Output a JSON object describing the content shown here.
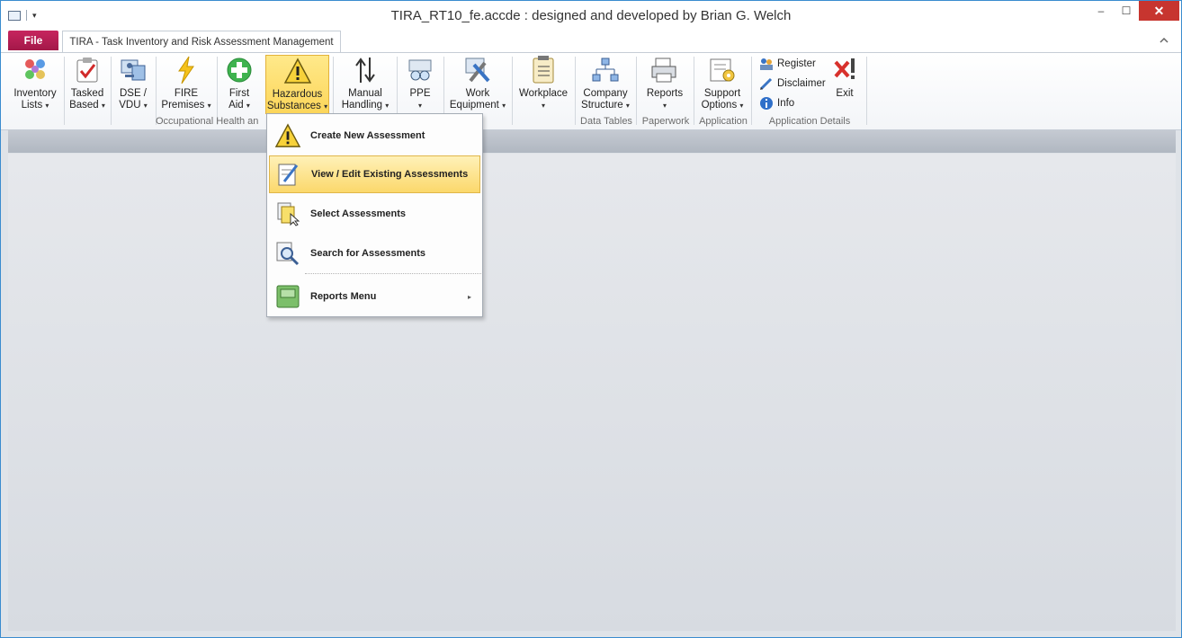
{
  "window": {
    "title": "TIRA_RT10_fe.accde : designed and developed by Brian G. Welch",
    "controls": {
      "minimize": "–",
      "maximize": "☐",
      "close": "✕"
    }
  },
  "tabs": {
    "file": "File",
    "main": "TIRA - Task Inventory and Risk Assessment Management"
  },
  "ribbon": {
    "buttons": [
      {
        "l1": "Inventory",
        "l2": "Lists"
      },
      {
        "l1": "Tasked",
        "l2": "Based"
      },
      {
        "l1": "DSE /",
        "l2": "VDU"
      },
      {
        "l1": "FIRE",
        "l2": "Premises"
      },
      {
        "l1": "First",
        "l2": "Aid"
      },
      {
        "l1": "Hazardous",
        "l2": "Substances"
      },
      {
        "l1": "Manual",
        "l2": "Handling"
      },
      {
        "l1": "PPE",
        "l2": ""
      },
      {
        "l1": "Work",
        "l2": "Equipment"
      },
      {
        "l1": "Workplace",
        "l2": ""
      },
      {
        "l1": "Company",
        "l2": "Structure"
      },
      {
        "l1": "Reports",
        "l2": ""
      },
      {
        "l1": "Support",
        "l2": "Options"
      },
      {
        "l1": "Exit",
        "l2": ""
      }
    ],
    "small_buttons": [
      "Register",
      "Disclaimer",
      "Info"
    ],
    "groups": [
      "Occupational Health an",
      "Data Tables",
      "Paperwork",
      "Application",
      "Application Details"
    ],
    "caret": "▾"
  },
  "menu": {
    "items": [
      "Create New Assessment",
      "View / Edit Existing Assessments",
      "Select Assessments",
      "Search for Assessments",
      "Reports Menu"
    ],
    "submenu_arrow": "▸"
  },
  "colors": {
    "file_tab": "#c7255f",
    "highlight": "#fbd86b",
    "close": "#c7352f",
    "accent": "#3a8ccf"
  }
}
